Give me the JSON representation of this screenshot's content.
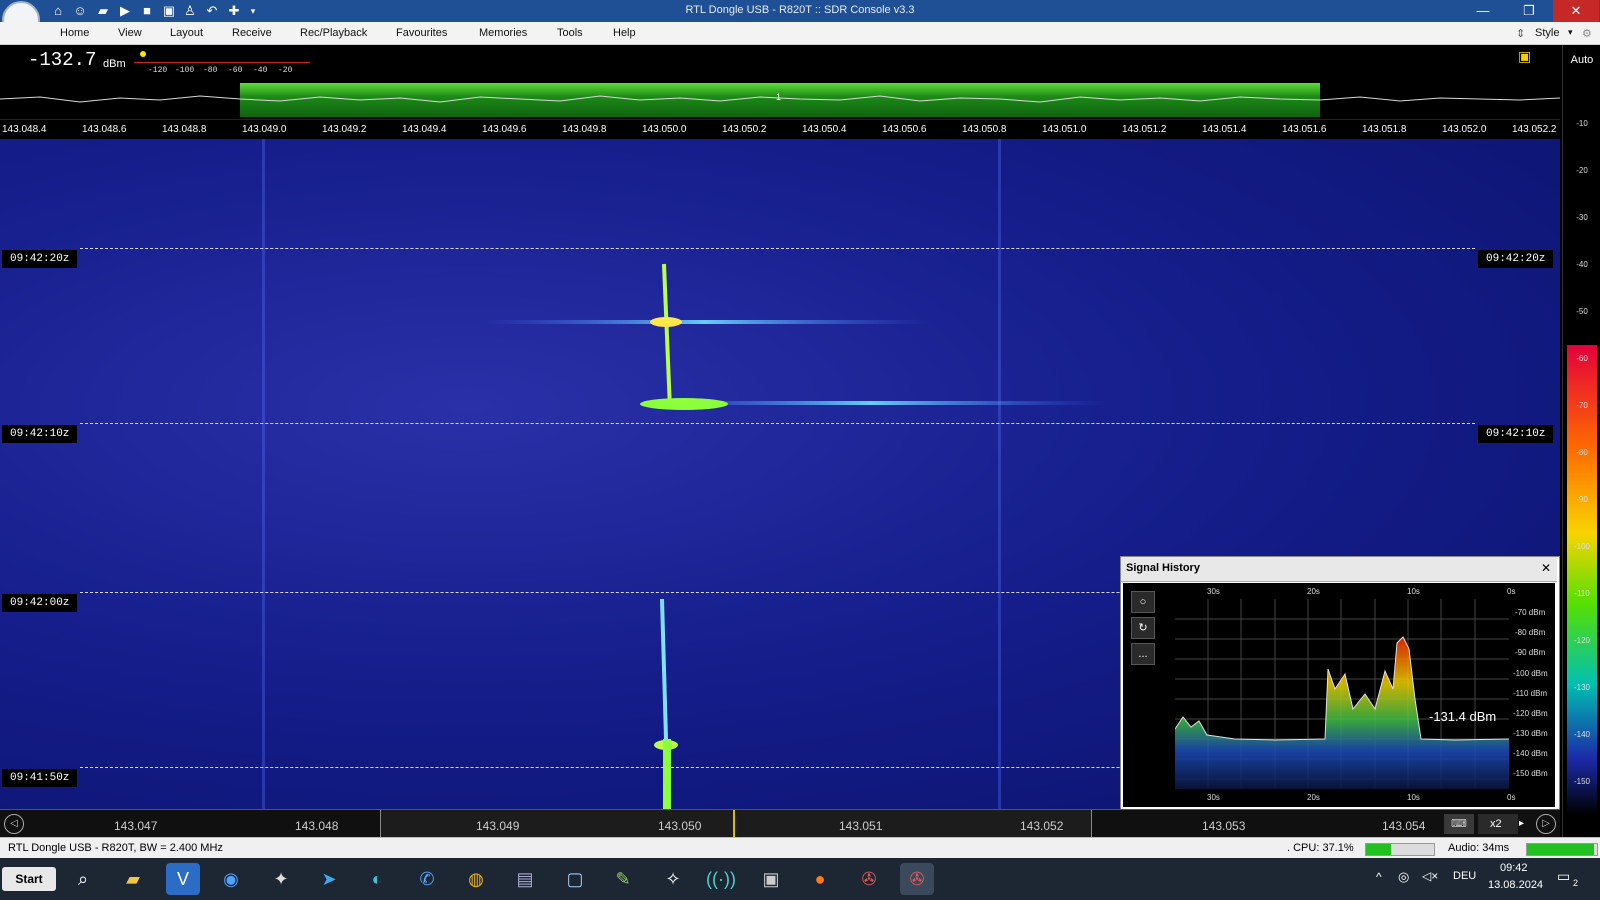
{
  "window": {
    "title": "RTL Dongle USB - R820T :: SDR Console v3.3"
  },
  "menu": [
    "Home",
    "View",
    "Layout",
    "Receive",
    "Rec/Playback",
    "Favourites",
    "Memories",
    "Tools",
    "Help"
  ],
  "style_label": "Style",
  "level": {
    "value": "-132.7",
    "unit": "dBm",
    "scale": [
      "-120",
      "-100",
      "-80",
      "-60",
      "-40",
      "-20"
    ]
  },
  "auto_label": "Auto",
  "vfo_marker": "1",
  "freq_axis": [
    "143.048.4",
    "143.048.6",
    "143.048.8",
    "143.049.0",
    "143.049.2",
    "143.049.4",
    "143.049.6",
    "143.049.8",
    "143.050.0",
    "143.050.2",
    "143.050.4",
    "143.050.6",
    "143.050.8",
    "143.051.0",
    "143.051.2",
    "143.051.4",
    "143.051.6",
    "143.051.8",
    "143.052.0",
    "143.052.2"
  ],
  "time_marks": [
    "09:42:20z",
    "09:42:10z",
    "09:42:00z",
    "09:41:50z"
  ],
  "right_scale": [
    "-10",
    "-20",
    "-30",
    "-40",
    "-50",
    "-60",
    "-70",
    "-80",
    "-90",
    "-100",
    "-110",
    "-120",
    "-130",
    "-140",
    "-150"
  ],
  "bottom_freq": [
    "143.047",
    "143.048",
    "143.049",
    "143.050",
    "143.051",
    "143.052",
    "143.053",
    "143.054"
  ],
  "zoom_label": "x2",
  "signal_history": {
    "title": "Signal History",
    "time_labels": [
      "30s",
      "20s",
      "10s",
      "0s"
    ],
    "dbm_labels": [
      "-70 dBm",
      "-80 dBm",
      "-90 dBm",
      "-100 dBm",
      "-110 dBm",
      "-120 dBm",
      "-130 dBm",
      "-140 dBm",
      "-150 dBm"
    ],
    "current": "-131.4 dBm",
    "tools": [
      "○",
      "↻",
      "..."
    ]
  },
  "status": {
    "left": "RTL Dongle USB - R820T, BW = 2.400 MHz",
    "cpu": ". CPU: 37.1%",
    "cpu_fraction": 0.37,
    "audio": "Audio: 34ms",
    "audio_fraction": 0.95
  },
  "taskbar": {
    "start": "Start",
    "lang": "DEU",
    "time": "09:42",
    "date": "13.08.2024",
    "notif": "2"
  },
  "colors": {
    "titlebar": "#1f4f94",
    "spectrum_band": "#2fb52a",
    "waterfall": "#141d8a"
  }
}
